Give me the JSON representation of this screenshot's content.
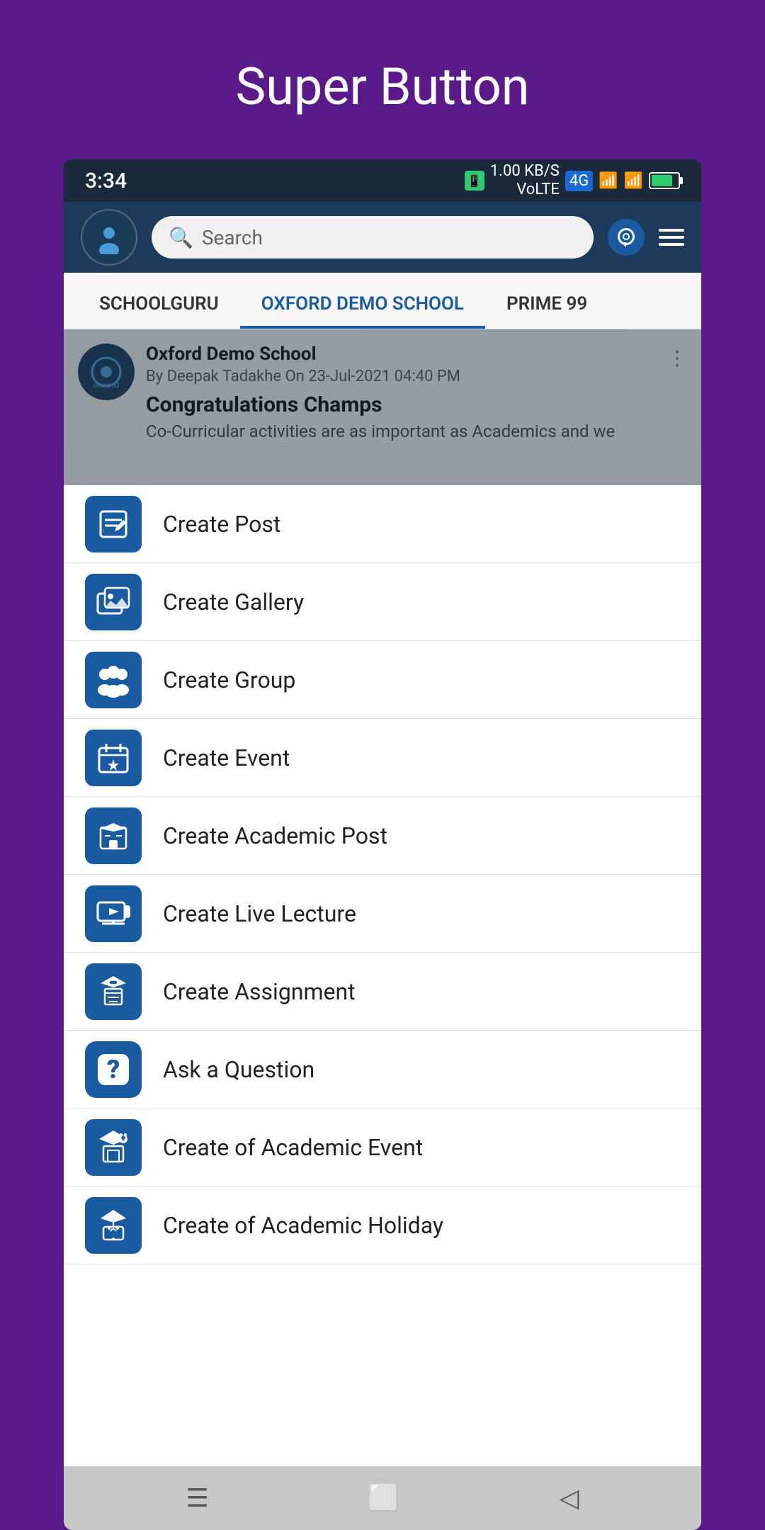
{
  "page": {
    "title": "Super Button",
    "background_color": "#5a1a8a"
  },
  "status_bar": {
    "time": "3:34",
    "network_info": "1.00 KB/S",
    "network_type": "VoLTE",
    "signal": "4G",
    "battery_percent": 80
  },
  "header": {
    "search_placeholder": "Search",
    "avatar_label": "User Avatar"
  },
  "tabs": [
    {
      "id": "schoolguru",
      "label": "SCHOOLGURU",
      "active": false
    },
    {
      "id": "oxford",
      "label": "OXFORD DEMO SCHOOL",
      "active": true
    },
    {
      "id": "prime99",
      "label": "PRIME 99",
      "active": false
    }
  ],
  "post": {
    "school_name": "Oxford Demo School",
    "meta": "By Deepak Tadakhe On 23-Jul-2021 04:40 PM",
    "title": "Congratulations Champs",
    "body": "Co-Curricular activities are as important as Academics and we"
  },
  "menu_items": [
    {
      "id": "create-post",
      "label": "Create Post",
      "icon": "post"
    },
    {
      "id": "create-gallery",
      "label": "Create Gallery",
      "icon": "gallery"
    },
    {
      "id": "create-group",
      "label": "Create Group",
      "icon": "group"
    },
    {
      "id": "create-event",
      "label": "Create Event",
      "icon": "event"
    },
    {
      "id": "create-academic-post",
      "label": "Create Academic Post",
      "icon": "academic-post"
    },
    {
      "id": "create-live-lecture",
      "label": "Create Live Lecture",
      "icon": "live-lecture"
    },
    {
      "id": "create-assignment",
      "label": "Create Assignment",
      "icon": "assignment"
    },
    {
      "id": "ask-question",
      "label": "Ask a Question",
      "icon": "question"
    },
    {
      "id": "create-academic-event",
      "label": "Create of Academic Event",
      "icon": "academic-event"
    },
    {
      "id": "create-academic-holiday",
      "label": "Create of Academic Holiday",
      "icon": "academic-holiday"
    }
  ],
  "bottom_nav": {
    "menu_label": "Menu",
    "home_label": "Home",
    "back_label": "Back"
  }
}
